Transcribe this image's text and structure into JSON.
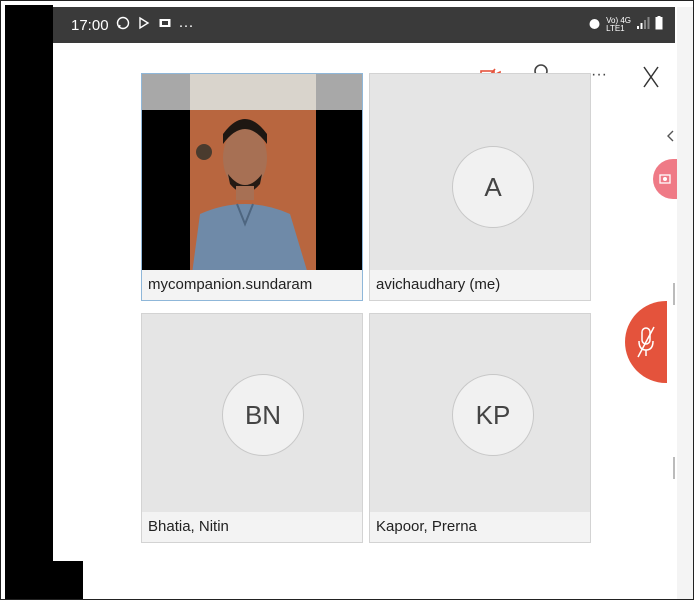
{
  "status_bar": {
    "time": "17:00",
    "left_extra": "···",
    "network": "Vo) 4G\nLTE1"
  },
  "toolbar": {
    "more_label": "···",
    "close_label": "X"
  },
  "participants": [
    {
      "name": "mycompanion.sundaram",
      "initials": "",
      "has_video": true
    },
    {
      "name": "avichaudhary (me)",
      "initials": "A",
      "has_video": false
    },
    {
      "name": "Bhatia, Nitin",
      "initials": "BN",
      "has_video": false
    },
    {
      "name": "Kapoor, Prerna",
      "initials": "KP",
      "has_video": false
    }
  ],
  "colors": {
    "accent_red": "#e4533c",
    "tile_bg": "#e5e5e5",
    "status_bar": "#3a3a3a"
  },
  "icons": {
    "camera_off": "video-off-icon",
    "participants": "person-list-icon",
    "mic_off": "mic-off-icon"
  }
}
